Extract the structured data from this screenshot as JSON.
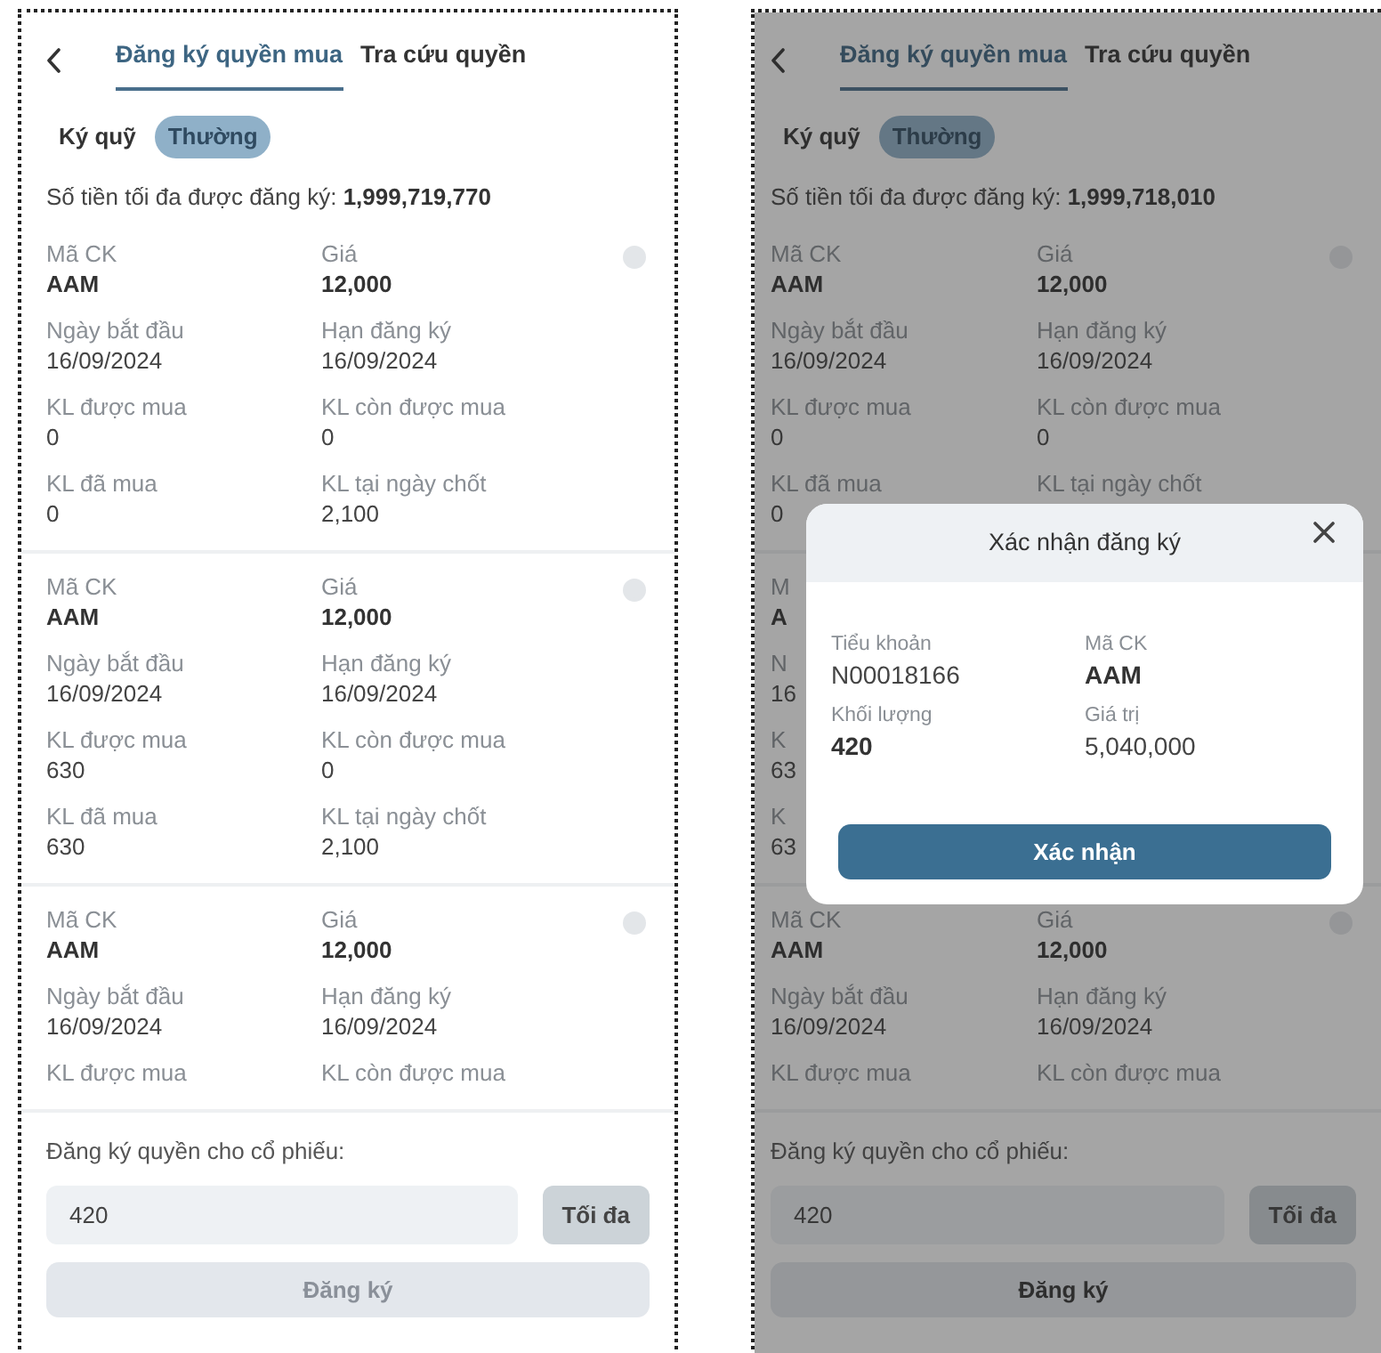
{
  "screens": [
    {
      "tabs": [
        {
          "label": "Đăng ký quyền mua",
          "selected": true
        },
        {
          "label": "Tra cứu quyền",
          "selected": false
        }
      ],
      "account_types": [
        {
          "label": "Ký quỹ",
          "selected": false
        },
        {
          "label": "Thường",
          "selected": true
        }
      ],
      "max_amount": "Số tiền tối đa được đăng ký: **1,999,719,770**",
      "cards": [
        {
          "selected": false,
          "rows": [
            [
              {
                "label": "Mã CK",
                "value": "AAM",
                "bold": true
              },
              {
                "label": "Giá",
                "value": "12,000",
                "bold": true
              }
            ],
            [
              {
                "label": "Ngày bắt đầu",
                "value": "16/09/2024",
                "bold": false
              },
              {
                "label": "Hạn đăng ký",
                "value": "16/09/2024",
                "bold": false
              }
            ],
            [
              {
                "label": "KL được mua",
                "value": "0",
                "bold": false
              },
              {
                "label": "KL còn được mua",
                "value": "0",
                "bold": false
              }
            ],
            [
              {
                "label": "KL đã mua",
                "value": "0",
                "bold": false
              },
              {
                "label": "KL tại ngày chốt",
                "value": "2,100",
                "bold": false
              }
            ]
          ]
        },
        {
          "selected": false,
          "rows": [
            [
              {
                "label": "Mã CK",
                "value": "AAM",
                "bold": true
              },
              {
                "label": "Giá",
                "value": "12,000",
                "bold": true
              }
            ],
            [
              {
                "label": "Ngày bắt đầu",
                "value": "16/09/2024",
                "bold": false
              },
              {
                "label": "Hạn đăng ký",
                "value": "16/09/2024",
                "bold": false
              }
            ],
            [
              {
                "label": "KL được mua",
                "value": "630",
                "bold": false
              },
              {
                "label": "KL còn được mua",
                "value": "0",
                "bold": false
              }
            ],
            [
              {
                "label": "KL đã mua",
                "value": "630",
                "bold": false
              },
              {
                "label": "KL tại ngày chốt",
                "value": "2,100",
                "bold": false
              }
            ]
          ]
        },
        {
          "selected": false,
          "rows": [
            [
              {
                "label": "Mã CK",
                "value": "AAM",
                "bold": true
              },
              {
                "label": "Giá",
                "value": "12,000",
                "bold": true
              }
            ],
            [
              {
                "label": "Ngày bắt đầu",
                "value": "16/09/2024",
                "bold": false
              },
              {
                "label": "Hạn đăng ký",
                "value": "16/09/2024",
                "bold": false
              }
            ],
            [
              {
                "label": "KL được mua"
              },
              {
                "label": "KL còn được mua"
              }
            ]
          ]
        }
      ],
      "form": {
        "label": "Đăng ký quyền cho cổ phiếu:",
        "quantity": "420",
        "max_button": "Tối đa",
        "submit_button": "Đăng ký",
        "submit_disabled": true
      }
    },
    {
      "tabs": [
        {
          "label": "Đăng ký quyền mua",
          "selected": true
        },
        {
          "label": "Tra cứu quyền",
          "selected": false
        }
      ],
      "account_types": [
        {
          "label": "Ký quỹ",
          "selected": false
        },
        {
          "label": "Thường",
          "selected": true
        }
      ],
      "max_amount": "Số tiền tối đa được đăng ký: **1,999,718,010**",
      "cards": [
        {
          "selected": false,
          "rows": [
            [
              {
                "label": "Mã CK",
                "value": "AAM",
                "bold": true
              },
              {
                "label": "Giá",
                "value": "12,000",
                "bold": true
              }
            ],
            [
              {
                "label": "Ngày bắt đầu",
                "value": "16/09/2024",
                "bold": false
              },
              {
                "label": "Hạn đăng ký",
                "value": "16/09/2024",
                "bold": false
              }
            ],
            [
              {
                "label": "KL được mua",
                "value": "0",
                "bold": false
              },
              {
                "label": "KL còn được mua",
                "value": "0",
                "bold": false
              }
            ],
            [
              {
                "label": "KL đã mua",
                "value": "0",
                "bold": false
              },
              {
                "label": "KL tại ngày chốt"
              }
            ]
          ]
        },
        {
          "rows": [
            [
              {
                "label": "M",
                "value": "A",
                "bold": true
              }
            ],
            [
              {
                "label": "N",
                "value": "16",
                "bold": false
              }
            ],
            [
              {
                "label": "K",
                "value": "63",
                "bold": false
              }
            ],
            [
              {
                "label": "K",
                "value": "63",
                "bold": false
              }
            ]
          ]
        },
        {
          "selected": false,
          "rows": [
            [
              {
                "label": "Mã CK",
                "value": "AAM",
                "bold": true
              },
              {
                "label": "Giá",
                "value": "12,000",
                "bold": true
              }
            ],
            [
              {
                "label": "Ngày bắt đầu",
                "value": "16/09/2024",
                "bold": false
              },
              {
                "label": "Hạn đăng ký",
                "value": "16/09/2024",
                "bold": false
              }
            ],
            [
              {
                "label": "KL được mua"
              },
              {
                "label": "KL còn được mua"
              }
            ]
          ]
        }
      ],
      "form": {
        "label": "Đăng ký quyền cho cổ phiếu:",
        "quantity": "420",
        "max_button": "Tối đa",
        "submit_button": "Đăng ký",
        "submit_disabled": false
      },
      "dialog": {
        "title": "Xác nhận đăng ký",
        "fields": [
          {
            "label": "Tiểu khoản",
            "value": "N00018166",
            "bold": false
          },
          {
            "label": "Mã CK",
            "value": "AAM",
            "bold": true
          },
          {
            "label": "Khối lượng",
            "value": "420",
            "bold": true
          },
          {
            "label": "Giá trị",
            "value": "5,040,000",
            "bold": false
          }
        ],
        "confirm_button": "Xác nhận"
      }
    }
  ]
}
